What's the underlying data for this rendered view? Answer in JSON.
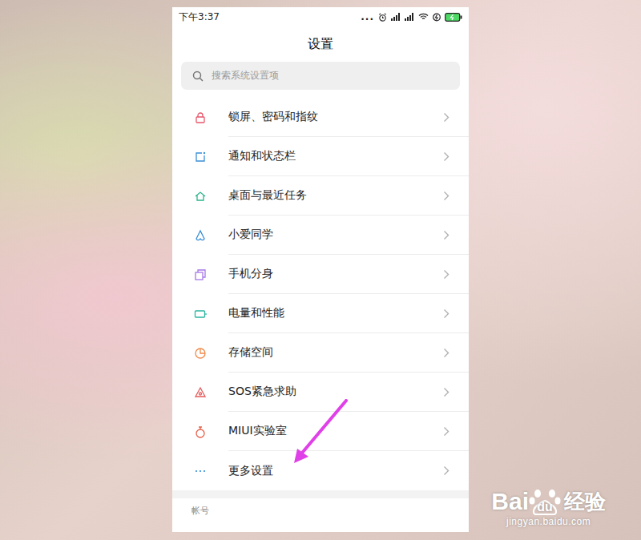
{
  "status_bar": {
    "time": "下午3:37",
    "dots": "..."
  },
  "title": "设置",
  "search": {
    "placeholder": "搜索系统设置项"
  },
  "items": [
    {
      "label": "锁屏、密码和指纹",
      "color": "#e8566b",
      "pointed": false
    },
    {
      "label": "通知和状态栏",
      "color": "#3a8fd8",
      "pointed": false
    },
    {
      "label": "桌面与最近任务",
      "color": "#2bb58a",
      "pointed": false
    },
    {
      "label": "小爱同学",
      "color": "#3a8fd8",
      "pointed": false
    },
    {
      "label": "手机分身",
      "color": "#a678e8",
      "pointed": false
    },
    {
      "label": "电量和性能",
      "color": "#2bb5a0",
      "pointed": false
    },
    {
      "label": "存储空间",
      "color": "#f08a4a",
      "pointed": false
    },
    {
      "label": "SOS紧急求助",
      "color": "#e65a5a",
      "pointed": false
    },
    {
      "label": "MIUI实验室",
      "color": "#e8604a",
      "pointed": false
    },
    {
      "label": "更多设置",
      "color": "#3a8fd8",
      "pointed": true
    }
  ],
  "section": {
    "label": "帐号"
  },
  "watermark": {
    "brand": "Bai",
    "paw_text": "du",
    "suffix": "经验",
    "url": "jingyan.baidu.com"
  }
}
